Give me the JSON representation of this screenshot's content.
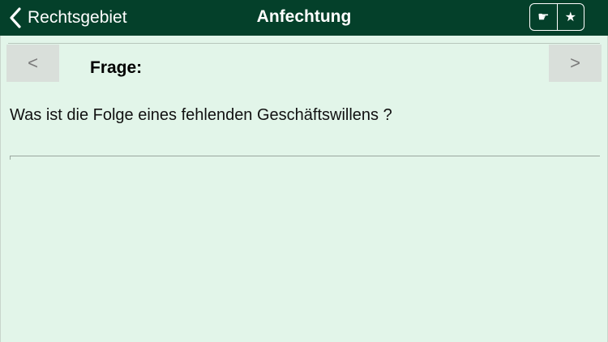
{
  "navbar": {
    "back_label": "Rechtsgebiet",
    "title": "Anfechtung",
    "actions": [
      {
        "name": "hand-icon",
        "glyph": "☛"
      },
      {
        "name": "star-icon",
        "glyph": "★"
      }
    ]
  },
  "pager": {
    "prev_label": "<",
    "next_label": ">"
  },
  "card": {
    "label": "Frage:",
    "question": "Was ist die Folge eines fehlenden Geschäftswillens ?"
  },
  "colors": {
    "navbar_bg": "#04402a",
    "content_bg": "#e2f5e9",
    "pager_button_bg": "#d9dfda"
  }
}
